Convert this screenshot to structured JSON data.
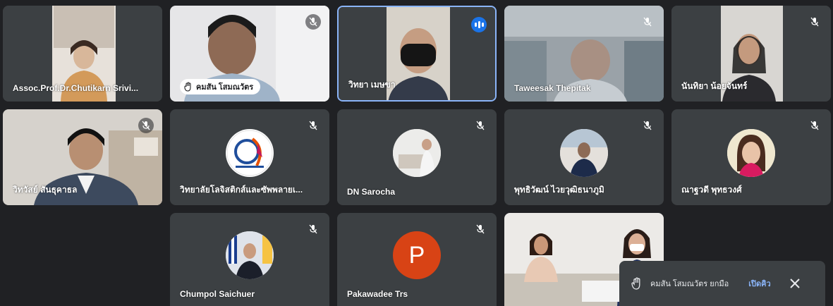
{
  "participants": [
    {
      "name": "Assoc.Prof.Dr.Chutikarn Srivi..."
    },
    {
      "name": "คมสัน โสมณวัตร"
    },
    {
      "name": "วิทยา เมษขา"
    },
    {
      "name": "Taweesak Thepitak"
    },
    {
      "name": "นันทิยา น้อยจันทร์"
    },
    {
      "name": "วิทวัสย์ สันธุคาธล"
    },
    {
      "name": "วิทยาลัยโลจิสติกส์และซัพพลายเ..."
    },
    {
      "name": "DN Sarocha"
    },
    {
      "name": "พุทธิวัฒน์ ไวยวุฒิธนาภูมิ"
    },
    {
      "name": "ณาฐวดี พุทธวงศ์"
    },
    {
      "name": "Chumpol Saichuer"
    },
    {
      "name": "Pakawadee Trs",
      "initial": "P"
    }
  ],
  "toast": {
    "message": "คมสัน โสมณวัตร ยกมือ",
    "action": "เปิดคิว"
  },
  "colors": {
    "background": "#202124",
    "tile": "#3c4043",
    "active_border": "#8ab4f8",
    "speaking": "#1a73e8",
    "avatar_p": "#d84315",
    "link": "#8ab4f8"
  },
  "icons": {
    "muted": "mic-off-icon",
    "speaking": "audio-level-icon",
    "hand": "raised-hand-icon",
    "close": "close-icon"
  }
}
